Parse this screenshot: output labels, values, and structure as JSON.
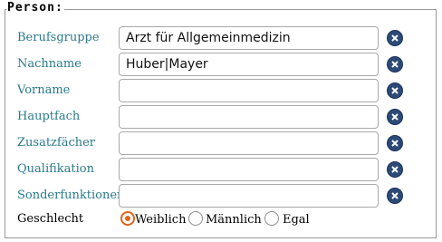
{
  "section": {
    "legend": "Person:"
  },
  "fields": [
    {
      "label": "Berufsgruppe",
      "value": "Arzt für Allgemeinmedizin"
    },
    {
      "label": "Nachname",
      "value": "Huber|Mayer"
    },
    {
      "label": "Vorname",
      "value": ""
    },
    {
      "label": "Hauptfach",
      "value": ""
    },
    {
      "label": "Zusatzfächer",
      "value": ""
    },
    {
      "label": "Qualifikation",
      "value": ""
    },
    {
      "label": "Sonderfunktionen",
      "value": ""
    }
  ],
  "gender": {
    "label": "Geschlecht",
    "options": [
      "Weiblich",
      "Männlich",
      "Egal"
    ],
    "selected": "Weiblich"
  },
  "colors": {
    "label": "#2a7a8c",
    "clear_icon": "#2b4a78",
    "radio_selected": "#e0621a"
  }
}
